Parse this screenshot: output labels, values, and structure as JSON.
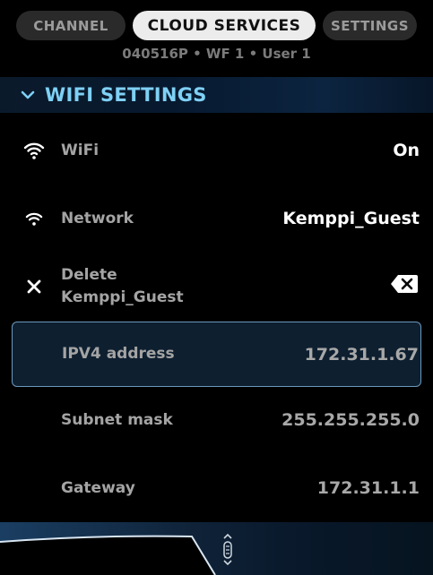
{
  "tabs": {
    "channel": "CHANNEL",
    "cloud_services": "CLOUD SERVICES",
    "settings": "SETTINGS"
  },
  "subtitle": "040516P • WF 1 • User 1",
  "section": {
    "title": "WIFI SETTINGS",
    "icon": "chevron-down-icon"
  },
  "rows": {
    "wifi": {
      "label": "WiFi",
      "value": "On",
      "icon": "wifi-icon"
    },
    "network": {
      "label": "Network",
      "value": "Kemppi_Guest",
      "icon": "wifi-icon"
    },
    "delete": {
      "label_line1": "Delete",
      "label_line2": "Kemppi_Guest",
      "icon": "close-icon",
      "action_icon": "backspace-icon"
    },
    "ipv4": {
      "label": "IPV4 address",
      "value": "172.31.1.67"
    },
    "subnet": {
      "label": "Subnet mask",
      "value": "255.255.255.0"
    },
    "gateway": {
      "label": "Gateway",
      "value": "172.31.1.1"
    }
  },
  "colors": {
    "accent": "#7fd0f5",
    "focus_border": "#6c98bb",
    "header_bg": "#0c2440"
  }
}
